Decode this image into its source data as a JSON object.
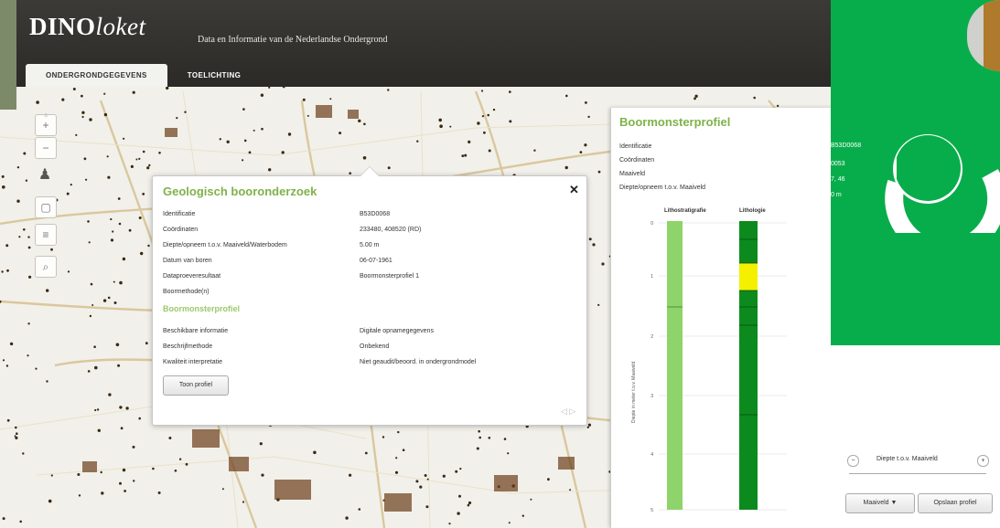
{
  "app": {
    "logo_bold": "DINO",
    "logo_italic": "loket",
    "tagline": "Data en Informatie van de Nederlandse Ondergrond"
  },
  "tabs": [
    {
      "label": "ONDERGRONDGEGEVENS"
    },
    {
      "label": "TOELICHTING"
    }
  ],
  "popup": {
    "title": "Geologisch booronderzoek",
    "rows": [
      {
        "label": "Identificatie",
        "value": "B53D0068"
      },
      {
        "label": "Coördinaten",
        "value": "233480, 408520 (RD)"
      },
      {
        "label": "Diepte/opneem t.o.v. Maaiveld/Waterbodem",
        "value": "5.00 m"
      },
      {
        "label": "Datum van boren",
        "value": "06-07-1961"
      },
      {
        "label": "Dataproeveresultaat",
        "value": "Boormonsterprofiel 1"
      },
      {
        "label": "Boormethode(n)",
        "value": ""
      }
    ],
    "subtitle": "Boormonsterprofiel",
    "rows2": [
      {
        "label": "Beschikbare informatie",
        "value": "Digitale opnamegegevens"
      },
      {
        "label": "Beschrijfmethode",
        "value": "Onbekend"
      },
      {
        "label": "Kwaliteit interpretatie",
        "value": "Niet geaudit/beoord. in ondergrondmodel"
      }
    ],
    "show_button": "Toon profiel",
    "pager": "◁ ▷",
    "close": "✕"
  },
  "panel": {
    "title": "Boormonsterprofiel",
    "labels": [
      "Identificatie",
      "Coördinaten",
      "Maaiveld",
      "Diepte/opneem t.o.v. Maaiveld"
    ],
    "identifier": "B53D0068",
    "fragments": [
      "0053",
      "7, 46",
      "0 m"
    ],
    "col1_title": "Lithostratigrafie",
    "col2_title": "Lithologie",
    "axis_label": "Diepte in meter t.o.v. Maaiveld",
    "depth_ticks": [
      "0",
      "1",
      "2",
      "3",
      "4",
      "5"
    ],
    "depth_control": "Diepte t.o.v. Maaiveld",
    "maaiveld_select": "Maaiveld ▼",
    "save_button": "Opslaan profiel"
  },
  "colors": {
    "brand_green": "#08ad4b",
    "title_green": "#7fb249",
    "light_green": "#8fd46a",
    "dark_green": "#0d8a1d",
    "yellow": "#f4f000"
  },
  "icons": [
    "zoom-in-icon",
    "zoom-out-icon",
    "person-icon",
    "pan-icon",
    "layers-icon",
    "search-icon",
    "close-icon"
  ]
}
